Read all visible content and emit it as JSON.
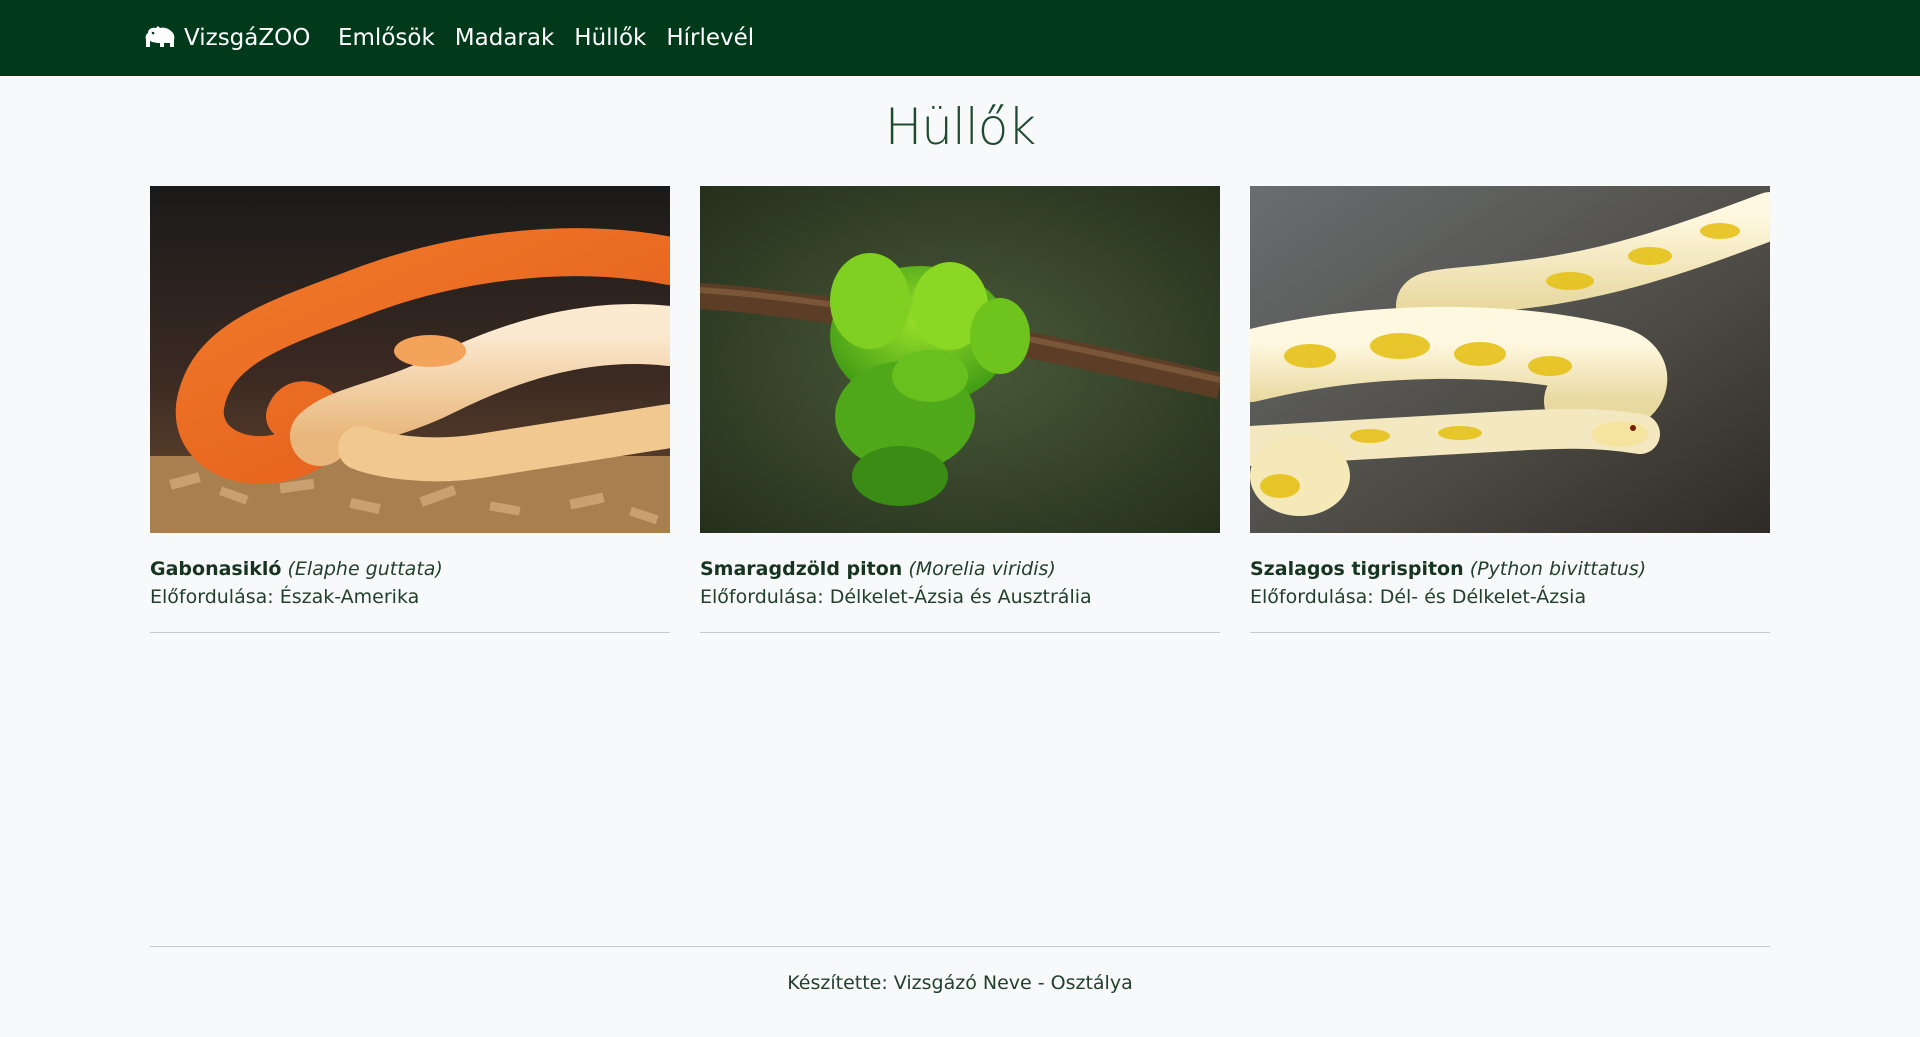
{
  "navbar": {
    "brand": "VizsgáZOO",
    "brand_icon": "hippo-icon",
    "links": [
      "Emlősök",
      "Madarak",
      "Hüllők",
      "Hírlevél"
    ],
    "background": "#003a1b"
  },
  "main": {
    "title": "Hüllők",
    "cards": [
      {
        "name": "Gabonasikló",
        "latin": "(Elaphe guttata)",
        "origin": "Előfordulása: Észak-Amerika",
        "image": "orange-corn-snake-photo"
      },
      {
        "name": "Smaragdzöld piton",
        "latin": "(Morelia viridis)",
        "origin": "Előfordulása: Délkelet-Ázsia és Ausztrália",
        "image": "green-tree-python-photo"
      },
      {
        "name": "Szalagos tigrispiton",
        "latin": "(Python bivittatus)",
        "origin": "Előfordulása: Dél- és Délkelet-Ázsia",
        "image": "albino-burmese-python-photo"
      }
    ]
  },
  "footer": {
    "text": "Készítette: Vizsgázó Neve - Osztálya"
  }
}
